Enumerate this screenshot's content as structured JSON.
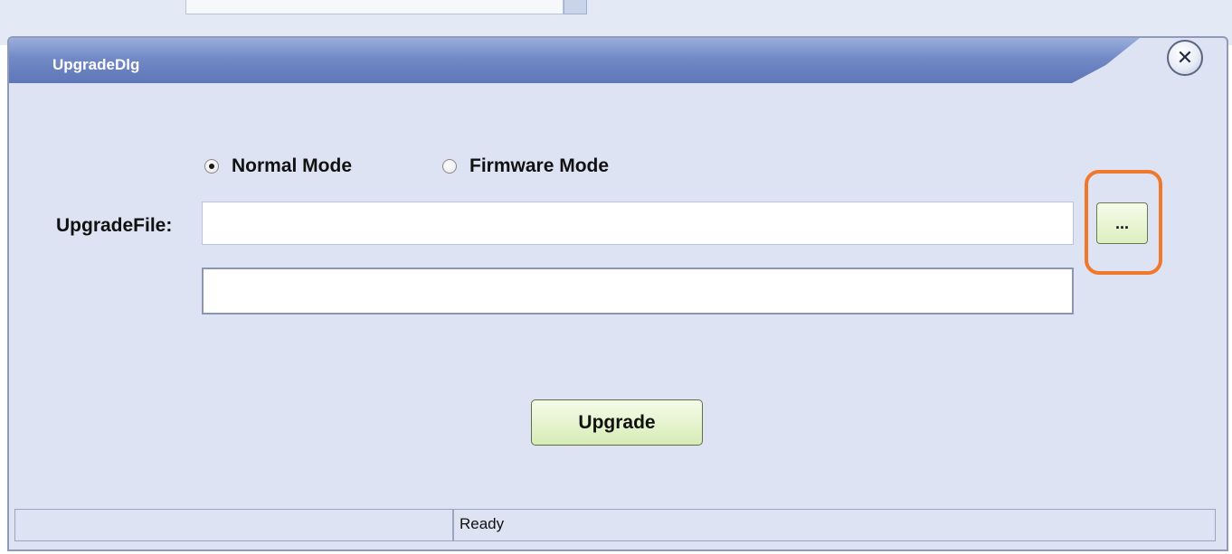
{
  "dialog": {
    "title": "UpgradeDlg",
    "close_icon": "close-icon"
  },
  "mode": {
    "options": [
      {
        "label": "Normal Mode",
        "checked": true
      },
      {
        "label": "Firmware Mode",
        "checked": false
      }
    ]
  },
  "upgrade_file": {
    "label": "UpgradeFile:",
    "value": "",
    "browse_label": "...",
    "browse_highlight_color": "#f0782a"
  },
  "progress_field": {
    "value": ""
  },
  "actions": {
    "upgrade_label": "Upgrade"
  },
  "statusbar": {
    "left": "",
    "right": "Ready"
  }
}
